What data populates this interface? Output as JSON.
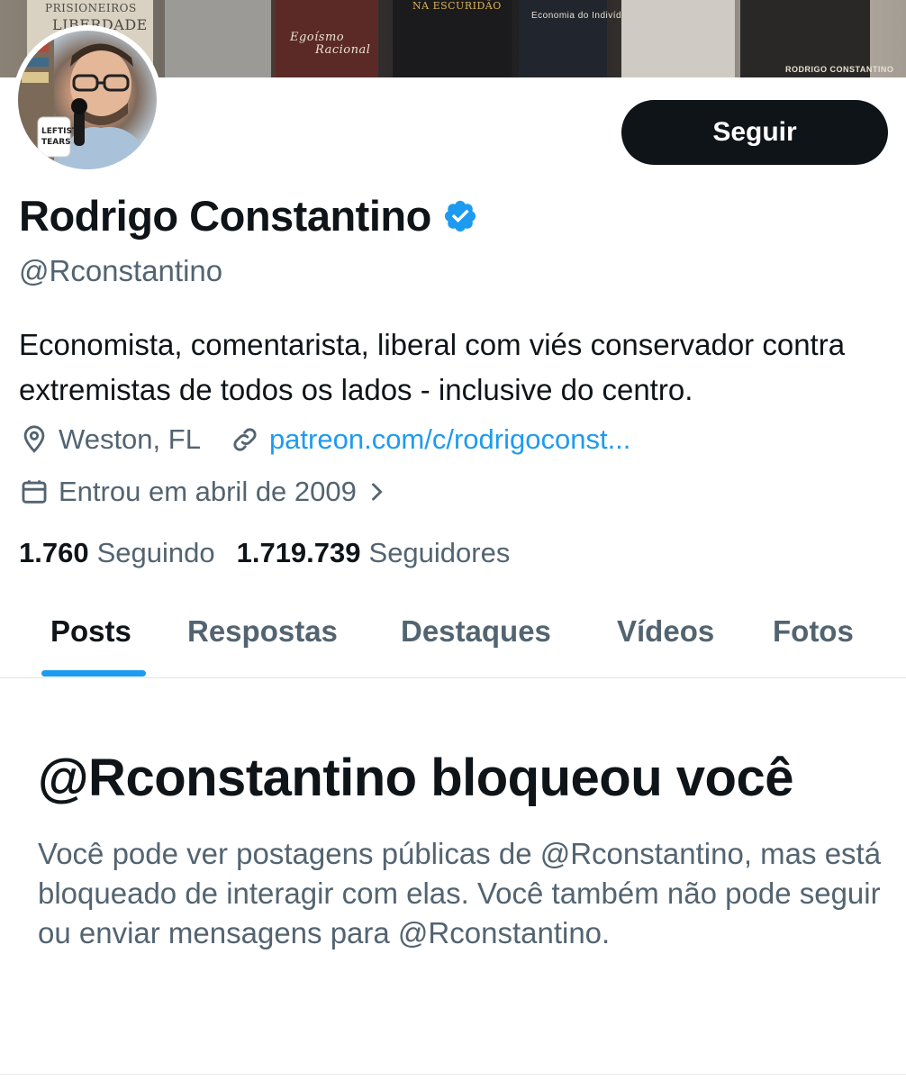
{
  "banner": {
    "books": [
      {
        "title_top": "PRISIONEIROS",
        "title_bottom": "LIBERDADE"
      },
      {
        "title_top": "Egoísmo",
        "title_bottom": "Racional"
      },
      {
        "title_top": "NA ESCURIDÃO",
        "title_bottom": ""
      },
      {
        "title_top": "Economia do Indivíduo",
        "title_bottom": ""
      },
      {
        "title_top": "RODRIGO CONSTANTINO",
        "title_bottom": ""
      }
    ]
  },
  "profile": {
    "display_name": "Rodrigo Constantino",
    "verified_icon": "verified-badge-icon",
    "handle": "@Rconstantino",
    "bio": "Economista, comentarista, liberal com viés conservador contra extremistas de todos os lados - inclusive do centro.",
    "location": "Weston, FL",
    "website": "patreon.com/c/rodrigoconst...",
    "joined": "Entrou em abril de 2009",
    "following_count": "1.760",
    "following_label": "Seguindo",
    "followers_count": "1.719.739",
    "followers_label": "Seguidores",
    "follow_button": "Seguir"
  },
  "tabs": [
    {
      "label": "Posts",
      "active": true
    },
    {
      "label": "Respostas",
      "active": false
    },
    {
      "label": "Destaques",
      "active": false
    },
    {
      "label": "Vídeos",
      "active": false
    },
    {
      "label": "Fotos",
      "active": false
    }
  ],
  "blocked": {
    "title": "@Rconstantino bloqueou você",
    "description": "Você pode ver postagens públicas de @Rconstantino, mas está bloqueado de interagir com elas. Você também não pode seguir ou enviar mensagens para @Rconstantino."
  },
  "colors": {
    "accent": "#1d9bf0",
    "text_primary": "#0f1419",
    "text_secondary": "#536471",
    "button_bg": "#0f1419"
  }
}
